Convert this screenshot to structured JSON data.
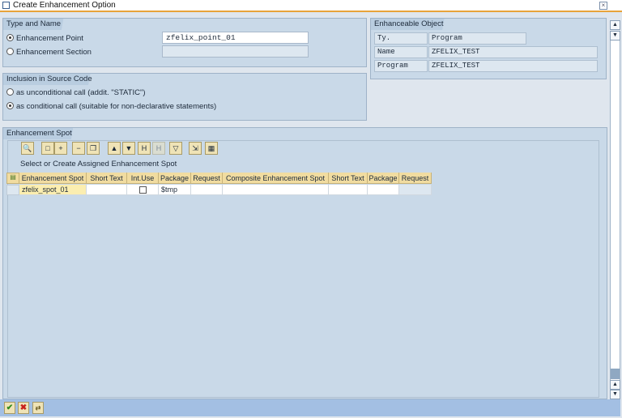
{
  "window": {
    "title": "Create Enhancement Option",
    "close_icon": "close-icon"
  },
  "type_and_name": {
    "label": "Type and Name",
    "options": [
      {
        "label": "Enhancement Point",
        "selected": true,
        "value": "zfelix_point_01"
      },
      {
        "label": "Enhancement Section",
        "selected": false,
        "value": ""
      }
    ]
  },
  "inclusion": {
    "label": "Inclusion in Source Code",
    "options": [
      {
        "label": "as unconditional call (addit. \"STATIC\")",
        "selected": false
      },
      {
        "label": "as conditional call (suitable for non-declarative statements)",
        "selected": true
      }
    ]
  },
  "enhanceable_object": {
    "label": "Enhanceable Object",
    "rows": [
      {
        "label": "Ty.",
        "value": "Program"
      },
      {
        "label": "Name",
        "value": "ZFELIX_TEST"
      },
      {
        "label": "Program",
        "value": "ZFELIX_TEST"
      }
    ]
  },
  "enhancement_spot": {
    "label": "Enhancement Spot",
    "toolbar": [
      "details-icon",
      "create-icon",
      "insert-row-icon",
      "delete-row-icon",
      "copy-icon",
      "sort-ascending-icon",
      "sort-descending-icon",
      "find-icon",
      "find-next-icon",
      "filter-icon",
      "export-icon",
      "layout-icon"
    ],
    "grid_title": "Select or Create Assigned Enhancement Spot",
    "columns": [
      "Enhancement Spot",
      "Short Text",
      "Int.Use",
      "Package",
      "Request",
      "Composite Enhancement Spot",
      "Short Text",
      "Package",
      "Request"
    ],
    "rows": [
      {
        "enh_spot": "zfelix_spot_01",
        "short_text": "",
        "int_use": false,
        "package": "$tmp",
        "request": "",
        "composite": "",
        "short_text2": "",
        "package2": "",
        "request2": ""
      }
    ]
  },
  "footer": {
    "buttons": [
      "continue-icon",
      "cancel-icon",
      "transport-icon"
    ]
  },
  "colors": {
    "toolbar_bg": "#a3bfe3",
    "group_bg": "#c9d9e8",
    "header_bg": "#f1dca0",
    "key_cell_bg": "#fbeeb0"
  }
}
